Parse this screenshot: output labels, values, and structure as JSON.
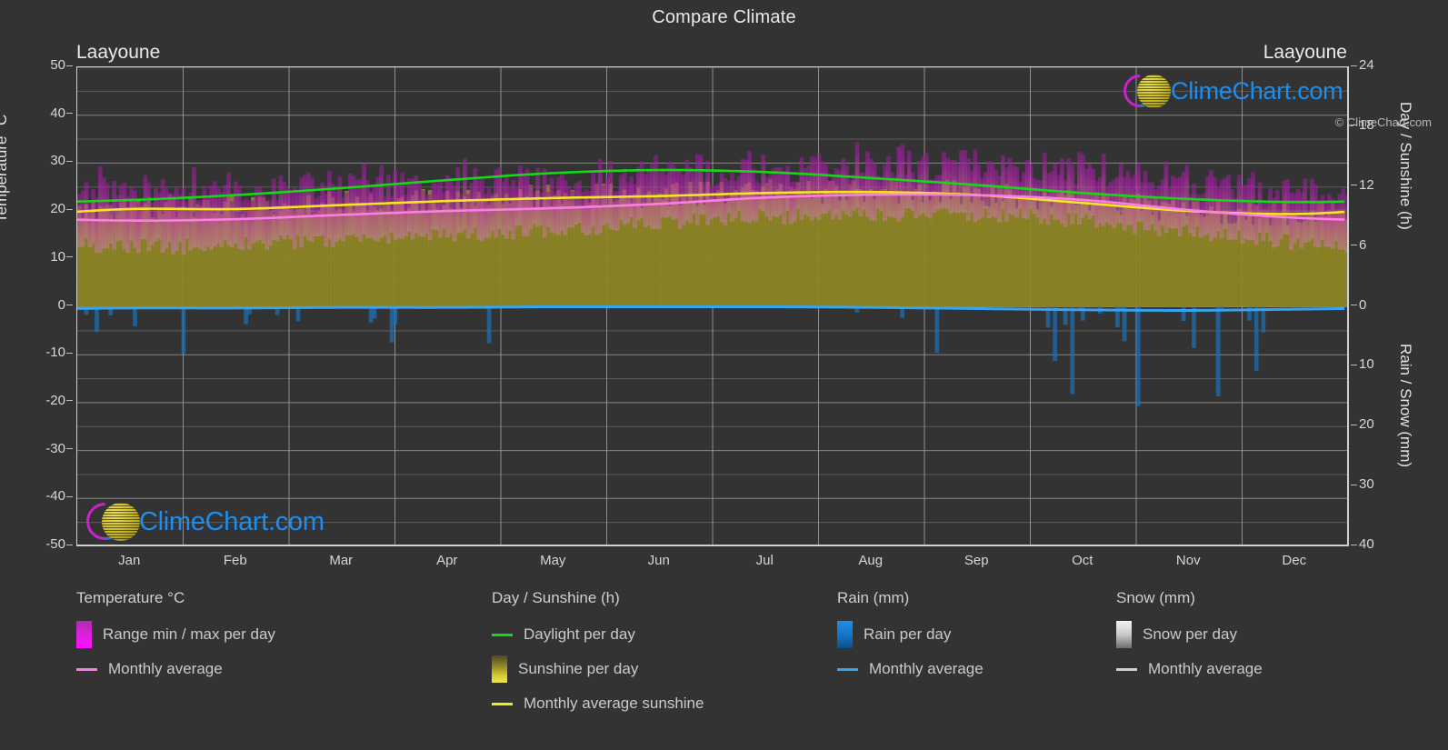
{
  "header": {
    "title": "Compare Climate",
    "location_left": "Laayoune",
    "location_right": "Laayoune"
  },
  "brand": {
    "wordmark": "ClimeChart.com",
    "copyright": "© ClimeChart.com",
    "accent_blue": "#1b8ef2",
    "accent_magenta": "#cc22cc",
    "accent_yellow": "#d8cc30"
  },
  "axes": {
    "left": {
      "label": "Temperature °C",
      "ticks": [
        "50",
        "40",
        "30",
        "20",
        "10",
        "0",
        "-10",
        "-20",
        "-30",
        "-40",
        "-50"
      ],
      "min": -50,
      "max": 50
    },
    "right_top": {
      "label": "Day / Sunshine (h)",
      "ticks": [
        "24",
        "18",
        "12",
        "6",
        "0"
      ],
      "min": 0,
      "max": 24
    },
    "right_bottom": {
      "label": "Rain / Snow (mm)",
      "ticks": [
        "10",
        "20",
        "30",
        "40"
      ],
      "min": 0,
      "max": 40
    },
    "x": {
      "ticks": [
        "Jan",
        "Feb",
        "Mar",
        "Apr",
        "May",
        "Jun",
        "Jul",
        "Aug",
        "Sep",
        "Oct",
        "Nov",
        "Dec"
      ]
    }
  },
  "legend": {
    "groups": [
      {
        "heading": "Temperature °C",
        "items": [
          {
            "label": "Range min / max per day",
            "marker": "swatch",
            "swatch_class": "sw-temp",
            "color": "#e01fe0"
          },
          {
            "label": "Monthly average",
            "marker": "line",
            "color": "#ff7ce8"
          }
        ]
      },
      {
        "heading": "Day / Sunshine (h)",
        "items": [
          {
            "label": "Daylight per day",
            "marker": "line",
            "color": "#16d916"
          },
          {
            "label": "Sunshine per day",
            "marker": "swatch",
            "swatch_class": "sw-sun",
            "color": "#a79b2c"
          },
          {
            "label": "Monthly average sunshine",
            "marker": "line",
            "color": "#f2e820"
          }
        ]
      },
      {
        "heading": "Rain (mm)",
        "items": [
          {
            "label": "Rain per day",
            "marker": "swatch",
            "swatch_class": "sw-rain",
            "color": "#1f8fe8"
          },
          {
            "label": "Monthly average",
            "marker": "line",
            "color": "#38a4f0"
          }
        ]
      },
      {
        "heading": "Snow (mm)",
        "items": [
          {
            "label": "Snow per day",
            "marker": "swatch",
            "swatch_class": "sw-snow",
            "color": "#dcdcdc"
          },
          {
            "label": "Monthly average",
            "marker": "line",
            "color": "#cfcfcf"
          }
        ]
      }
    ]
  },
  "chart_data": {
    "type": "area",
    "title": "Compare Climate",
    "subtitle": "Laayoune",
    "xlabel": "",
    "ylabel": "Temperature °C",
    "categories": [
      "Jan",
      "Feb",
      "Mar",
      "Apr",
      "May",
      "Jun",
      "Jul",
      "Aug",
      "Sep",
      "Oct",
      "Nov",
      "Dec"
    ],
    "ylim": [
      -50,
      50
    ],
    "y2lim_top": [
      0,
      24
    ],
    "y2lim_bottom": [
      0,
      40
    ],
    "grid": true,
    "legend_position": "bottom",
    "series": [
      {
        "name": "Monthly average temperature",
        "unit": "°C",
        "color": "#ff7ce8",
        "axis": "left",
        "values": [
          18.0,
          18.3,
          19.2,
          20.0,
          20.6,
          21.5,
          22.8,
          23.4,
          23.3,
          22.3,
          20.2,
          18.6
        ]
      },
      {
        "name": "Range max per day (monthly mean of daily max)",
        "unit": "°C",
        "color": "#e01fe0",
        "axis": "left",
        "values": [
          24.2,
          24.6,
          25.4,
          26.0,
          26.4,
          27.0,
          28.4,
          29.0,
          29.0,
          28.0,
          26.0,
          24.4
        ]
      },
      {
        "name": "Range min per day (monthly mean of daily min)",
        "unit": "°C",
        "color": "#e01fe0",
        "axis": "left",
        "values": [
          12.6,
          13.0,
          14.0,
          14.8,
          16.0,
          17.4,
          18.8,
          19.4,
          19.2,
          18.0,
          15.6,
          13.4
        ]
      },
      {
        "name": "Daylight per day",
        "unit": "h",
        "color": "#16d916",
        "axis": "right_top",
        "values": [
          10.7,
          11.2,
          11.9,
          12.7,
          13.4,
          13.7,
          13.5,
          12.9,
          12.2,
          11.4,
          10.8,
          10.5
        ]
      },
      {
        "name": "Monthly average sunshine",
        "unit": "h",
        "color": "#f2e820",
        "axis": "right_top",
        "values": [
          9.8,
          9.8,
          10.2,
          10.6,
          10.9,
          11.1,
          11.4,
          11.5,
          11.2,
          10.4,
          9.6,
          9.3
        ]
      },
      {
        "name": "Monthly average rain",
        "unit": "mm",
        "color": "#38a4f0",
        "axis": "right_bottom",
        "values": [
          0.2,
          0.2,
          0.1,
          0.1,
          0.0,
          0.0,
          0.0,
          0.1,
          0.3,
          0.5,
          0.6,
          0.4
        ]
      }
    ]
  }
}
